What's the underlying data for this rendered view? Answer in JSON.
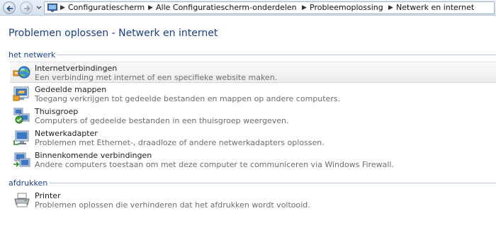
{
  "addressbar": {
    "breadcrumbs": [
      "Configuratiescherm",
      "Alle Configuratiescherm-onderdelen",
      "Probleemoplossing",
      "Netwerk en internet"
    ],
    "back_icon": "back-arrow-icon",
    "forward_icon": "forward-arrow-icon"
  },
  "page": {
    "title": "Problemen oplossen - Netwerk en internet"
  },
  "groups": [
    {
      "label": "het netwerk",
      "items": [
        {
          "name": "Internetverbindingen",
          "desc": "Een verbinding met internet of een specifieke website maken.",
          "icon": "globe-connection-icon"
        },
        {
          "name": "Gedeelde mappen",
          "desc": "Toegang verkrijgen tot gedeelde bestanden en mappen op andere computers.",
          "icon": "shared-folder-icon"
        },
        {
          "name": "Thuisgroep",
          "desc": "Computers of gedeelde bestanden in een thuisgroep weergeven.",
          "icon": "homegroup-icon"
        },
        {
          "name": "Netwerkadapter",
          "desc": "Problemen met Ethernet-, draadloze of andere netwerkadapters oplossen.",
          "icon": "network-adapter-icon"
        },
        {
          "name": "Binnenkomende verbindingen",
          "desc": "Andere computers toestaan om met deze computer te communiceren via Windows Firewall.",
          "icon": "incoming-connections-icon"
        }
      ]
    },
    {
      "label": "afdrukken",
      "items": [
        {
          "name": "Printer",
          "desc": "Problemen oplossen die verhinderen dat het afdrukken wordt voltooid.",
          "icon": "printer-icon"
        }
      ]
    }
  ]
}
